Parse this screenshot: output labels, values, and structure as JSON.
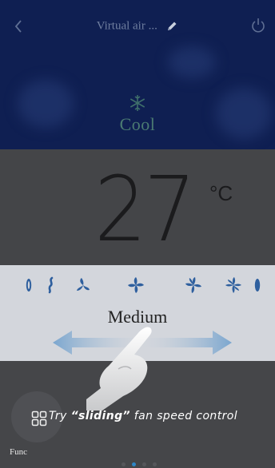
{
  "header": {
    "title": "Virtual air ...",
    "mode": "Cool"
  },
  "temperature": {
    "value": "27",
    "unit": "°C"
  },
  "fan": {
    "speed_label": "Medium",
    "icons": [
      "fan-speed-auto-icon",
      "fan-speed-1-icon",
      "fan-speed-2-icon",
      "fan-speed-3-icon",
      "fan-speed-4-icon",
      "fan-speed-5-icon",
      "fan-speed-max-icon"
    ]
  },
  "tutorial": {
    "hint_prefix": "Try ",
    "hint_quoted": "“sliding”",
    "hint_suffix": " fan speed control"
  },
  "footer": {
    "func_label": "Func",
    "page_count": 4,
    "active_page": 2
  },
  "colors": {
    "header_bg": "#0f1f52",
    "mode_text": "#4b7b72",
    "fan_band": "#d3d6dc",
    "fan_icon": "#2e5f9e",
    "active_dot": "#2f86c6"
  }
}
